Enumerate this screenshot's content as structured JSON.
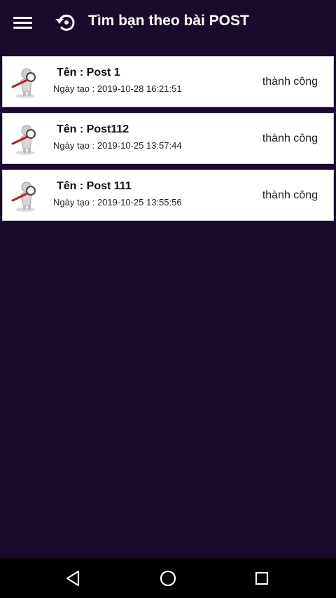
{
  "app_bar": {
    "title": "Tìm bạn theo bài POST",
    "menu_icon": "hamburger-menu-icon",
    "title_icon": "history-icon"
  },
  "posts": [
    {
      "name": "Tên : Post 1",
      "date": "Ngày tạo : 2019-10-28 16:21:51",
      "status": "thành công",
      "icon": "magnifier-person-icon"
    },
    {
      "name": "Tên : Post112",
      "date": "Ngày tạo : 2019-10-25 13:57:44",
      "status": "thành công",
      "icon": "magnifier-person-icon"
    },
    {
      "name": "Tên : Post 111",
      "date": "Ngày tạo : 2019-10-25 13:55:56",
      "status": "thành công",
      "icon": "magnifier-person-icon"
    }
  ],
  "nav_bar": {
    "back_icon": "back-icon",
    "home_icon": "home-icon",
    "recents_icon": "recents-icon"
  },
  "colors": {
    "background": "#1a0a2e",
    "card": "#ffffff",
    "nav_bar": "#000000"
  }
}
